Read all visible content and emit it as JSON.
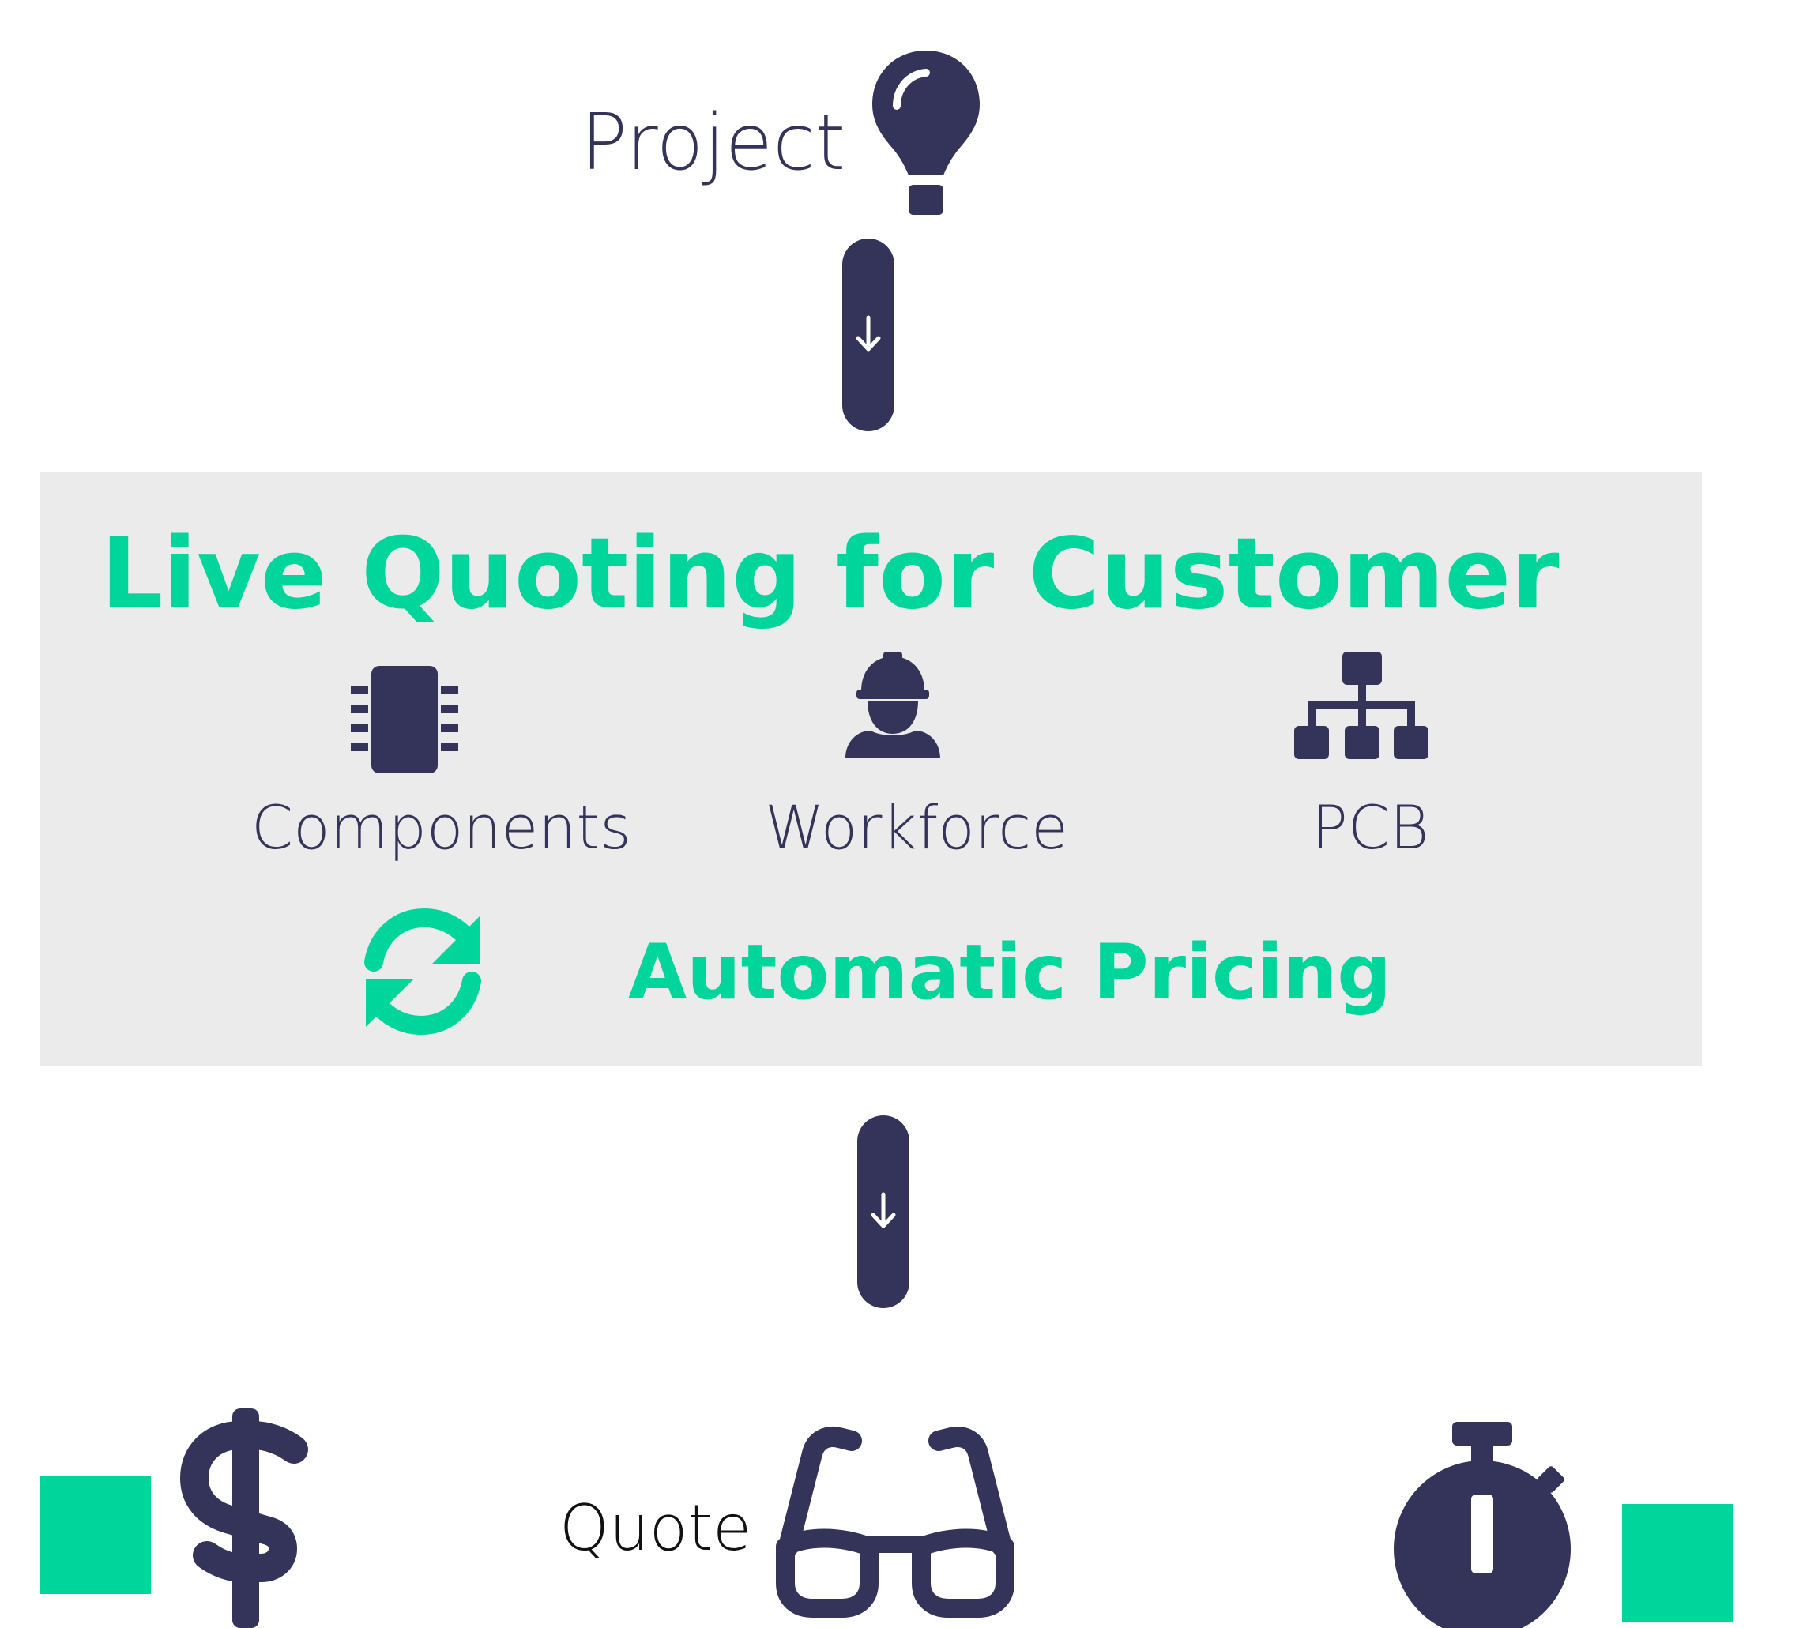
{
  "colors": {
    "navy": "#34345a",
    "green": "#00d59c",
    "panel_bg": "#ebebeb"
  },
  "top": {
    "project_label": "Project",
    "project_icon": "lightbulb-icon"
  },
  "panel": {
    "title": "Live Quoting for Customer",
    "items": [
      {
        "label": "Components",
        "icon": "chip-icon"
      },
      {
        "label": "Workforce",
        "icon": "worker-icon"
      },
      {
        "label": "PCB",
        "icon": "sitemap-icon"
      }
    ],
    "pricing_label": "Automatic Pricing",
    "pricing_icon": "sync-icon"
  },
  "bottom": {
    "quote_label": "Quote",
    "icons": [
      "dollar-icon",
      "glasses-icon",
      "stopwatch-icon"
    ]
  }
}
